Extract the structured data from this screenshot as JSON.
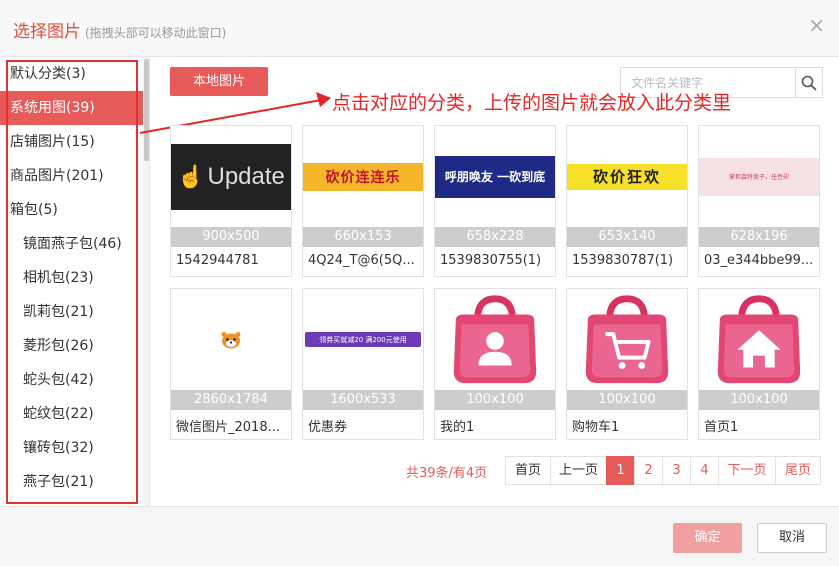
{
  "dialog": {
    "title": "选择图片",
    "hint": "(拖拽头部可以移动此窗口)",
    "close_label": "×"
  },
  "sidebar": {
    "items": [
      {
        "label": "默认分类(3)",
        "level": 0,
        "active": false
      },
      {
        "label": "系统用图(39)",
        "level": 0,
        "active": true
      },
      {
        "label": "店铺图片(15)",
        "level": 0,
        "active": false
      },
      {
        "label": "商品图片(201)",
        "level": 0,
        "active": false
      },
      {
        "label": "箱包(5)",
        "level": 0,
        "active": false
      },
      {
        "label": "镜面燕子包(46)",
        "level": 1,
        "active": false
      },
      {
        "label": "相机包(23)",
        "level": 1,
        "active": false
      },
      {
        "label": "凯莉包(21)",
        "level": 1,
        "active": false
      },
      {
        "label": "菱形包(26)",
        "level": 1,
        "active": false
      },
      {
        "label": "蛇头包(42)",
        "level": 1,
        "active": false
      },
      {
        "label": "蛇纹包(22)",
        "level": 1,
        "active": false
      },
      {
        "label": "镶砖包(32)",
        "level": 1,
        "active": false
      },
      {
        "label": "燕子包(21)",
        "level": 1,
        "active": false
      }
    ]
  },
  "toolbar": {
    "upload_label": "本地图片",
    "search_placeholder": "文件名关键字"
  },
  "annotation": {
    "text": "点击对应的分类，上传的图片就会放入此分类里",
    "color": "#e52525"
  },
  "images": [
    {
      "dim": "900x500",
      "name": "1542944781",
      "thumb_text": "Update"
    },
    {
      "dim": "660x153",
      "name": "4Q24_T@6(5Q...",
      "thumb_text": "砍价连连乐"
    },
    {
      "dim": "658x228",
      "name": "1539830755(1)",
      "thumb_text": "呼朋唤友 一砍到底"
    },
    {
      "dim": "653x140",
      "name": "1539830787(1)",
      "thumb_text": "砍价狂欢"
    },
    {
      "dim": "628x196",
      "name": "03_e344bbe99...",
      "thumb_text": "掌柜森特卖子，任性砍"
    },
    {
      "dim": "2860x1784",
      "name": "微信图片_2018...",
      "thumb_text": ""
    },
    {
      "dim": "1600x533",
      "name": "优惠券",
      "thumb_text": "领券买就减20 满200元使用"
    },
    {
      "dim": "100x100",
      "name": "我的1",
      "thumb_text": ""
    },
    {
      "dim": "100x100",
      "name": "购物车1",
      "thumb_text": ""
    },
    {
      "dim": "100x100",
      "name": "首页1",
      "thumb_text": ""
    }
  ],
  "pagination": {
    "total_text": "共39条/有4页",
    "first": "首页",
    "prev": "上一页",
    "pages": [
      "1",
      "2",
      "3",
      "4"
    ],
    "current": "1",
    "next": "下一页",
    "last": "尾页"
  },
  "footer": {
    "ok_label": "确定",
    "cancel_label": "取消"
  },
  "colors": {
    "accent": "#e65a5a",
    "ok_disabled": "#f1a0a0",
    "icon_pink": "#e24672"
  }
}
